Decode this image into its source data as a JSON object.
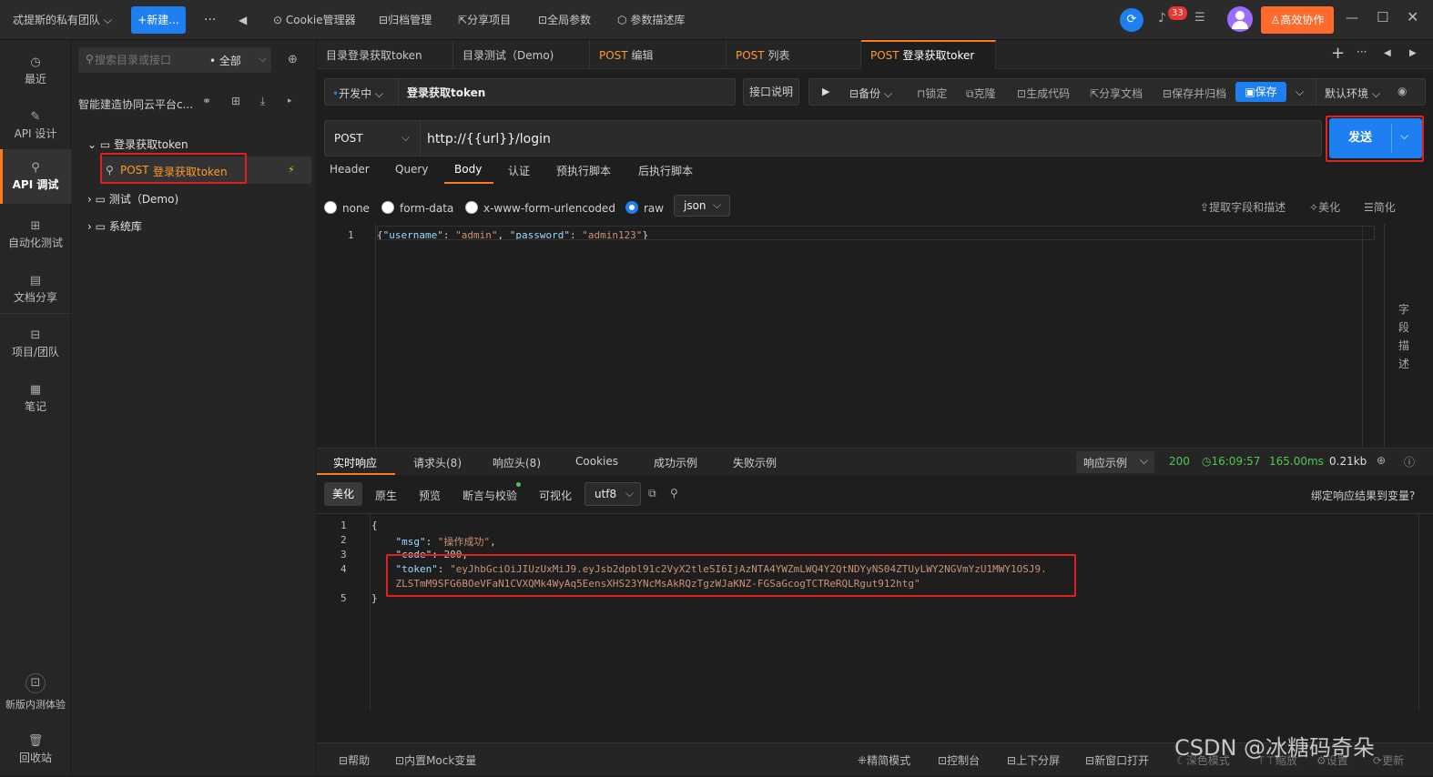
{
  "topbar": {
    "team": "忒提斯的私有团队",
    "new_btn": "+新建...",
    "more": "···",
    "back": "◀",
    "items": [
      "Cookie管理器",
      "归档管理",
      "分享项目",
      "全局参数",
      "参数描述库"
    ],
    "notif_count": "33",
    "collab_btn": "高效协作"
  },
  "leftnav": {
    "items": [
      "最近",
      "API 设计",
      "API 调试",
      "自动化测试",
      "文档分享",
      "项目/团队",
      "笔记"
    ],
    "bottom": [
      "新版内测体验",
      "回收站"
    ]
  },
  "tree": {
    "search_placeholder": "搜索目录或接口",
    "filter": "全部",
    "project": "智能建造协同云平台c...",
    "nodes": [
      {
        "label": "登录获取token"
      },
      {
        "method": "POST",
        "label": "登录获取token"
      },
      {
        "label": "测试（Demo)"
      },
      {
        "label": "系统库"
      }
    ]
  },
  "tabs": [
    {
      "method": "",
      "label": "目录登录获取token"
    },
    {
      "method": "",
      "label": "目录测试（Demo)"
    },
    {
      "method": "POST",
      "label": "编辑"
    },
    {
      "method": "POST",
      "label": "列表"
    },
    {
      "method": "POST",
      "label": "登录获取toker"
    }
  ],
  "request": {
    "status": "开发中",
    "name": "登录获取token",
    "doc_btn": "接口说明",
    "actions": [
      "备份",
      "锁定",
      "克隆",
      "生成代码",
      "分享文档",
      "保存并归档"
    ],
    "save": "保存",
    "env": "默认环境",
    "method": "POST",
    "url": "http://{{url}}/login",
    "send": "发送",
    "param_tabs": [
      "Header",
      "Query",
      "Body",
      "认证",
      "预执行脚本",
      "后执行脚本"
    ],
    "body_types": [
      "none",
      "form-data",
      "x-www-form-urlencoded",
      "raw"
    ],
    "raw_format": "json",
    "body_tools": [
      "提取字段和描述",
      "美化",
      "简化"
    ],
    "side_label": [
      "字",
      "段",
      "描",
      "述"
    ],
    "body_line_no": "1",
    "body_code": [
      {
        "t": "{",
        "c": "#d4d4d4"
      },
      {
        "t": "\"username\"",
        "c": "#9cdcfe"
      },
      {
        "t": ": ",
        "c": "#d4d4d4"
      },
      {
        "t": "\"admin\"",
        "c": "#ce9178"
      },
      {
        "t": ", ",
        "c": "#d4d4d4"
      },
      {
        "t": "\"password\"",
        "c": "#9cdcfe"
      },
      {
        "t": ": ",
        "c": "#d4d4d4"
      },
      {
        "t": "\"admin123\"",
        "c": "#ce9178"
      },
      {
        "t": "}",
        "c": "#d4d4d4"
      }
    ]
  },
  "response": {
    "tabs": [
      "实时响应",
      "请求头(8)",
      "响应头(8)",
      "Cookies",
      "成功示例",
      "失败示例"
    ],
    "example_select": "响应示例",
    "status_code": "200",
    "time": "16:09:57",
    "duration": "165.00ms",
    "size": "0.21kb",
    "view_tabs": [
      "美化",
      "原生",
      "预览",
      "断言与校验",
      "可视化"
    ],
    "encoding": "utf8",
    "bind_vars": "绑定响应结果到变量?",
    "lines": [
      {
        "no": "1",
        "parts": [
          {
            "t": "{",
            "c": "#d4d4d4"
          }
        ]
      },
      {
        "no": "2",
        "parts": [
          {
            "t": "    \"msg\"",
            "c": "#9cdcfe"
          },
          {
            "t": ": ",
            "c": "#d4d4d4"
          },
          {
            "t": "\"操作成功\"",
            "c": "#ce9178"
          },
          {
            "t": ",",
            "c": "#d4d4d4"
          }
        ]
      },
      {
        "no": "3",
        "parts": [
          {
            "t": "    \"code\"",
            "c": "#9cdcfe"
          },
          {
            "t": ": ",
            "c": "#d4d4d4"
          },
          {
            "t": "200",
            "c": "#b5cea8"
          },
          {
            "t": ",",
            "c": "#d4d4d4"
          }
        ]
      },
      {
        "no": "4",
        "parts": [
          {
            "t": "    \"token\"",
            "c": "#9cdcfe"
          },
          {
            "t": ": ",
            "c": "#d4d4d4"
          },
          {
            "t": "\"eyJhbGciOiJIUzUxMiJ9.eyJsb2dpbl91c2VyX2tleSI6IjAzNTA4YWZmLWQ4Y2QtNDYyNS04ZTUyLWY2NGVmYzU1MWY1OSJ9.",
            "c": "#ce9178"
          }
        ]
      },
      {
        "no": "",
        "parts": [
          {
            "t": "    ZLSTmM9SFG6BOeVFaN1CVXQMk4WyAq5EensXHS23YNcMsAkRQzTgzWJaKNZ-FGSaGcogTCTReRQLRgut912htg\"",
            "c": "#ce9178"
          }
        ]
      },
      {
        "no": "5",
        "parts": [
          {
            "t": "}",
            "c": "#d4d4d4"
          }
        ]
      }
    ]
  },
  "footer": {
    "left": [
      "帮助",
      "内置Mock变量"
    ],
    "right": [
      "精简模式",
      "控制台",
      "上下分屏",
      "新窗口打开",
      "深色模式",
      "缩放",
      "设置",
      "更新"
    ]
  },
  "watermark": "CSDN @冰糖码奇朵"
}
